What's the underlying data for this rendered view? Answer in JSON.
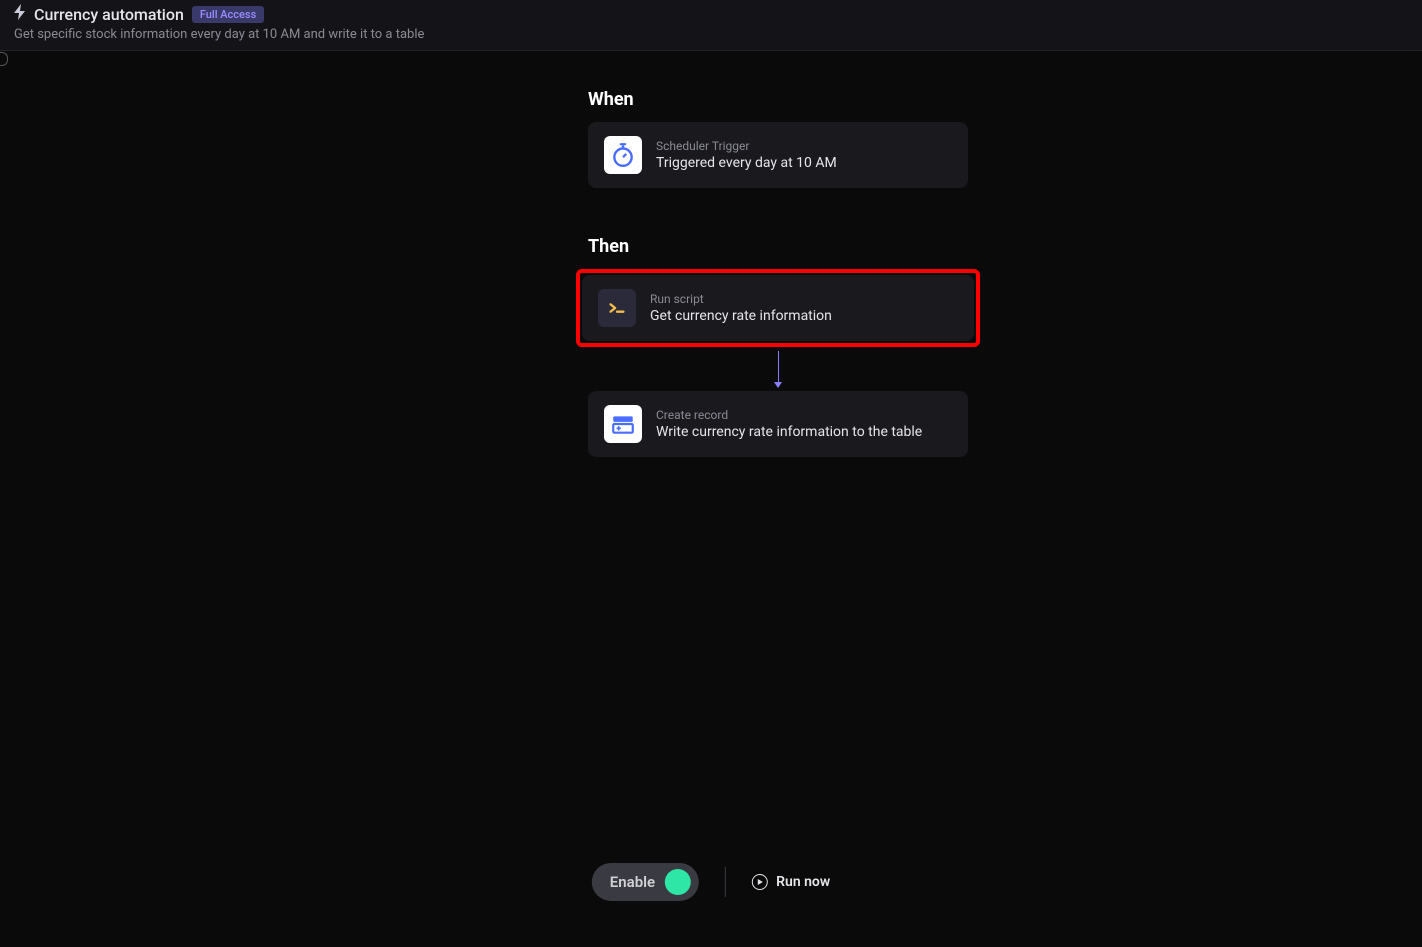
{
  "header": {
    "title": "Currency automation",
    "badge": "Full Access",
    "subtitle": "Get specific stock information every day at 10 AM and write it to a table"
  },
  "sections": {
    "when_label": "When",
    "then_label": "Then"
  },
  "cards": {
    "trigger": {
      "type": "Scheduler Trigger",
      "title": "Triggered every day at 10 AM"
    },
    "script": {
      "type": "Run script",
      "title": "Get currency rate information"
    },
    "create": {
      "type": "Create record",
      "title": "Write currency rate information to the table"
    }
  },
  "footer": {
    "toggle_label": "Enable",
    "run_label": "Run now"
  }
}
